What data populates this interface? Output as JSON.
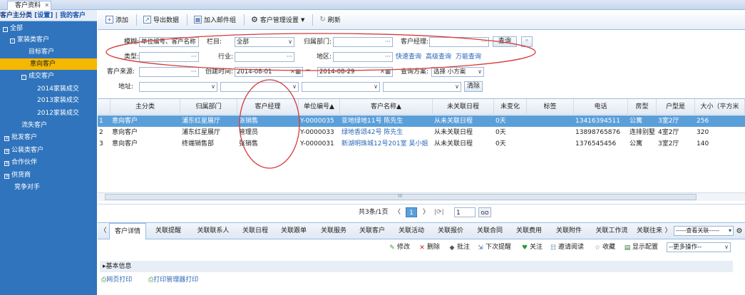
{
  "window": {
    "tab_title": "客户资料",
    "close_glyph": "✕"
  },
  "sidebar": {
    "header_prefix": "客户主分类",
    "header_settings": "[设置]",
    "header_sep": "|",
    "header_mine": "我的客户",
    "items": [
      {
        "label": "全部",
        "box": "-"
      },
      {
        "label": "家装类客户",
        "box": "-"
      },
      {
        "label": "目标客户",
        "box": ""
      },
      {
        "label": "意向客户",
        "box": ""
      },
      {
        "label": "成交客户",
        "box": "-"
      },
      {
        "label": "2014家装成交",
        "box": ""
      },
      {
        "label": "2013家装成交",
        "box": ""
      },
      {
        "label": "2012家装成交",
        "box": ""
      },
      {
        "label": "流失客户",
        "box": ""
      },
      {
        "label": "批发客户",
        "box": "+"
      },
      {
        "label": "公装类客户",
        "box": "+"
      },
      {
        "label": "合作伙伴",
        "box": "+"
      },
      {
        "label": "供货商",
        "box": "+"
      },
      {
        "label": "竞争对手",
        "box": ""
      }
    ]
  },
  "toolbar": {
    "add": "添加",
    "export": "导出数据",
    "add_mail": "加入邮件组",
    "settings": "客户管理设置",
    "refresh": "刷新"
  },
  "search": {
    "fuzzy_label": "模糊:",
    "fuzzy_value": "单位编号、客户名称",
    "column_label": "栏目:",
    "column_value": "全部",
    "dept_label": "归属部门:",
    "manager_label": "客户经理:",
    "query_button": "查询",
    "type_label": "类型:",
    "industry_label": "行业:",
    "region_label": "地区:",
    "quick_query": "快速查询",
    "advanced_query": "高级查询",
    "universal_query": "万能查询",
    "source_label": "客户来源:",
    "created_label": "创建时间:",
    "date_from": "2014-08-01",
    "date_to": "2014-08-29",
    "tilde": "~",
    "scheme_label": "查询方案:",
    "scheme_value": "选择    小方案",
    "address_label": "地址:",
    "clear_button": "清除",
    "dots": "···"
  },
  "grid": {
    "columns": [
      "主分类",
      "归属部门",
      "客户经理",
      "单位编号▲",
      "客户名称▲",
      "未关联日程",
      "未变化",
      "标签",
      "电话",
      "房型",
      "户型是",
      "大小（平方米"
    ],
    "rows": [
      {
        "num": "1",
        "cells": [
          "意向客户",
          "浦东红星展厅",
          "张销售",
          "Y-0000035",
          "亚地绿地11号 陈先生",
          "从未关联日程",
          "0天",
          "",
          "13416394511",
          "公寓",
          "3室2厅",
          "256"
        ]
      },
      {
        "num": "2",
        "cells": [
          "意向客户",
          "浦东红星展厅",
          "管理员",
          "Y-0000033",
          "绿地香颂42号 陈先生",
          "从未关联日程",
          "0天",
          "",
          "13898765876",
          "连排别墅",
          "4室2厅",
          "320"
        ]
      },
      {
        "num": "3",
        "cells": [
          "意向客户",
          "终端销售部",
          "张销售",
          "Y-0000031",
          "新湖明珠城12号201室 吴小姐",
          "从未关联日程",
          "0天",
          "",
          "1376545456",
          "公寓",
          "3室2厅",
          "140"
        ]
      }
    ],
    "scroll_glyph": "III"
  },
  "pager": {
    "summary": "共3条/1页",
    "first": "〈",
    "page": "1",
    "next": "〉",
    "refresh": "|⟳|",
    "page_input": "1",
    "go": "GO"
  },
  "detail_tabs": [
    "客户详情",
    "关联提醒",
    "关联联系人",
    "关联日程",
    "关联跟单",
    "关联服务",
    "关联客户",
    "关联活动",
    "关联报价",
    "关联合同",
    "关联费用",
    "关联附件",
    "关联工作流",
    "关联往来"
  ],
  "detail_nav": {
    "prev": "〈",
    "next": "〉",
    "more_select": "-----查看关联-----"
  },
  "actions": {
    "edit": "修改",
    "delete": "删除",
    "approve": "批注",
    "next_remind": "下次提醒",
    "follow": "关注",
    "invite": "邀请阅读",
    "favorite": "收藏",
    "display": "显示配置",
    "more_select": "--更多操作--"
  },
  "basic_info": "▸基本信息",
  "prints": {
    "web": "网页打印",
    "manager": "打印管理器打印"
  },
  "colors": {
    "sidebar": "#2f74bd",
    "selected_row": "#5b9fd9",
    "selected_tree": "#f5b700",
    "annotation": "#d63a3a"
  }
}
